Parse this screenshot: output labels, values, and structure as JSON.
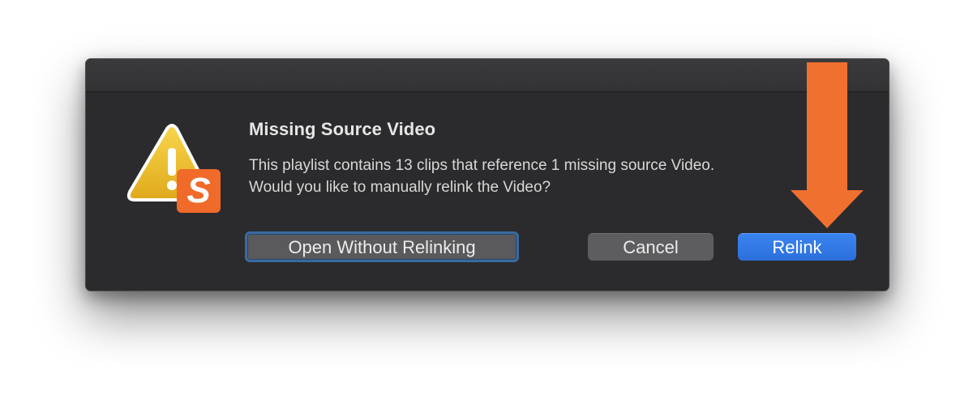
{
  "dialog": {
    "title": "Missing Source Video",
    "message_line1": "This playlist contains 13 clips that reference 1 missing source Video.",
    "message_line2": "Would you like to manually relink the Video?",
    "icon": "warning-with-app-badge-icon",
    "badge_letter": "S",
    "buttons": {
      "open_without_relinking": "Open Without Relinking",
      "cancel": "Cancel",
      "relink": "Relink"
    }
  },
  "annotation": {
    "icon": "down-arrow-icon",
    "color": "#f07030"
  },
  "colors": {
    "dialog_background": "#2b2b2d",
    "primary_button": "#2c6fdc",
    "warning_yellow": "#f2c531",
    "badge_orange": "#f06a2a"
  }
}
